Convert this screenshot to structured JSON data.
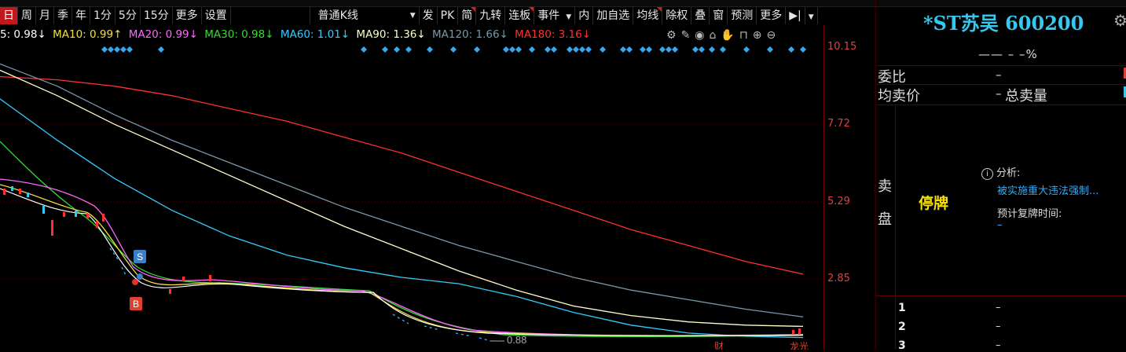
{
  "toolbar": {
    "items": [
      {
        "label": "日",
        "active": true
      },
      {
        "label": "周"
      },
      {
        "label": "月"
      },
      {
        "label": "季"
      },
      {
        "label": "年"
      },
      {
        "label": "1分"
      },
      {
        "label": "5分"
      },
      {
        "label": "15分"
      },
      {
        "label": "更多"
      },
      {
        "label": "设置"
      }
    ],
    "ktype": "普通K线",
    "items2": [
      {
        "label": "发"
      },
      {
        "label": "PK"
      },
      {
        "label": "简"
      },
      {
        "label": "九转"
      },
      {
        "label": "连板"
      },
      {
        "label": "事件",
        "dropdown": true
      },
      {
        "label": "内"
      },
      {
        "label": "加自选"
      },
      {
        "label": "均线"
      },
      {
        "label": "除权"
      },
      {
        "label": "叠"
      },
      {
        "label": "窗"
      },
      {
        "label": "预测"
      },
      {
        "label": "更多"
      },
      {
        "label": "▶|"
      }
    ]
  },
  "ma_bar": [
    {
      "text": "5: 0.98↓",
      "color": "#ffffff"
    },
    {
      "text": "MA10: 0.99↑",
      "color": "#f0e040"
    },
    {
      "text": "MA20: 0.99↓",
      "color": "#ff66ff"
    },
    {
      "text": "MA30: 0.98↓",
      "color": "#33dd33"
    },
    {
      "text": "MA60: 1.01↓",
      "color": "#33ccff"
    },
    {
      "text": "MA90: 1.36↓",
      "color": "#ffffcc"
    },
    {
      "text": "MA120: 1.66↓",
      "color": "#7799aa"
    },
    {
      "text": "MA180: 3.16↓",
      "color": "#ff3030"
    }
  ],
  "tool_icons": [
    "gear-icon",
    "pen-icon",
    "eye-icon",
    "lock-icon",
    "hand-icon",
    "unlock-icon",
    "zoom-in-icon",
    "zoom-out-icon"
  ],
  "y_axis": {
    "ticks": [
      "10.15",
      "7.72",
      "5.29",
      "2.85"
    ]
  },
  "chart_data": {
    "type": "line",
    "series": [
      {
        "name": "MA180",
        "color": "#ff3030",
        "values": [
          9.2,
          9.1,
          8.9,
          8.6,
          8.2,
          7.8,
          7.3,
          6.8,
          6.2,
          5.6,
          5.0,
          4.4,
          3.9,
          3.4,
          3.0
        ]
      },
      {
        "name": "MA120",
        "color": "#7799aa",
        "values": [
          9.6,
          8.9,
          8.0,
          7.2,
          6.5,
          5.8,
          5.1,
          4.5,
          3.9,
          3.4,
          2.9,
          2.5,
          2.2,
          1.9,
          1.66
        ]
      },
      {
        "name": "MA90",
        "color": "#ffffcc",
        "values": [
          9.4,
          8.6,
          7.7,
          6.9,
          6.1,
          5.3,
          4.5,
          3.8,
          3.1,
          2.5,
          2.0,
          1.7,
          1.5,
          1.4,
          1.36
        ]
      },
      {
        "name": "MA60",
        "color": "#33ccff",
        "values": [
          8.5,
          7.2,
          6.0,
          5.0,
          4.2,
          3.6,
          3.2,
          2.9,
          2.7,
          2.3,
          1.8,
          1.4,
          1.15,
          1.05,
          1.01
        ]
      }
    ],
    "annotations": [
      "S",
      "B",
      "0.88",
      "财",
      "龙光"
    ]
  },
  "stock": {
    "title": "*ST苏吴 600200",
    "price_line": "—— – –%"
  },
  "orderbook": {
    "weibi_label": "委比",
    "weibi_val": "–",
    "junmai_label": "均卖价",
    "junmai_val": "–",
    "total_sell_label": "总卖量",
    "sell_label_1": "卖",
    "sell_label_2": "盘",
    "halt": "停牌",
    "analysis_label": "分析:",
    "analysis_text": "被实施重大违法强制...",
    "resume_label": "预计复牌时间:",
    "resume_val": "–",
    "levels": [
      {
        "n": "1",
        "v": "–"
      },
      {
        "n": "2",
        "v": "–"
      },
      {
        "n": "3",
        "v": "–"
      }
    ]
  },
  "colors": {
    "accent": "#c0181b",
    "cyan": "#35c8f0",
    "halt": "#f5e000"
  }
}
